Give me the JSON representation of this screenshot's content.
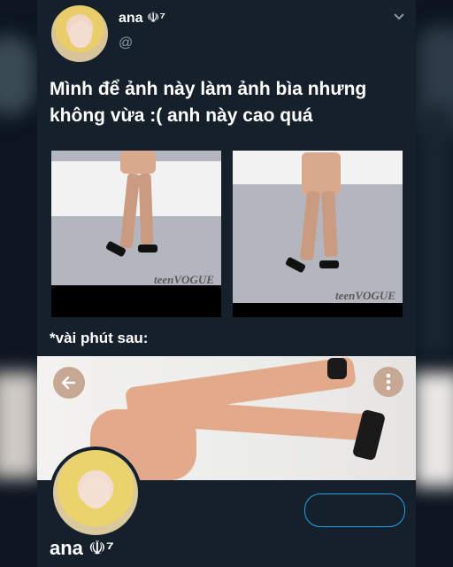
{
  "tweet": {
    "author_name": "ana ☫⁷",
    "handle": "@",
    "text": "Mình để ảnh này làm ảnh bìa nhưng không vừa :( anh này cao quá",
    "caption": "*vài phút sau:"
  },
  "images": {
    "left_logo": "teenVOGUE",
    "right_logo": "teenVOGUE"
  },
  "profile": {
    "display_name": "ana ☫⁷"
  },
  "icons": {
    "chevron": "chevron-down-icon",
    "back": "back-arrow-icon",
    "more": "more-vertical-icon"
  },
  "colors": {
    "background": "#15202b",
    "accent": "#1da1f2",
    "muted_text": "#8899a6"
  }
}
